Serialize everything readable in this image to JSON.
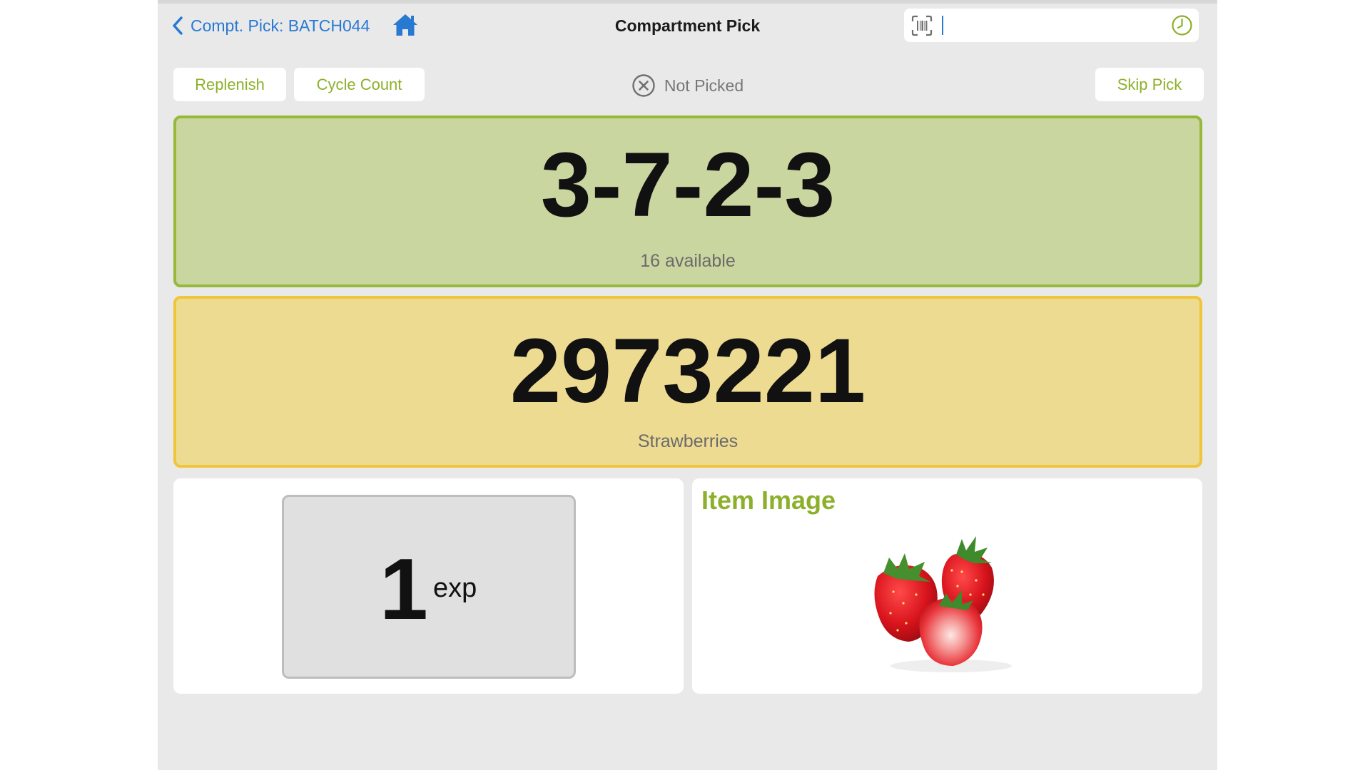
{
  "nav": {
    "back_label": "Compt. Pick: BATCH044",
    "title": "Compartment Pick",
    "scan_value": ""
  },
  "actions": {
    "replenish_label": "Replenish",
    "cycle_count_label": "Cycle Count",
    "skip_label": "Skip Pick"
  },
  "status": {
    "text": "Not Picked"
  },
  "location": {
    "code": "3-7-2-3",
    "available": "16 available"
  },
  "item": {
    "code": "2973221",
    "name": "Strawberries"
  },
  "quantity": {
    "value": "1",
    "unit": "exp"
  },
  "image_panel": {
    "title": "Item Image",
    "image": "strawberries"
  },
  "icons": [
    "chevron-left-icon",
    "home-icon",
    "barcode-scan-icon",
    "clock-icon",
    "x-circle-icon"
  ],
  "colors": {
    "link": "#2879d2",
    "accent_green": "#8db02b",
    "location_bg": "#cad6a0",
    "location_border": "#97b83a",
    "item_bg": "#eedb92",
    "item_border": "#f1c53a",
    "screen_bg": "#e9e9ea"
  }
}
